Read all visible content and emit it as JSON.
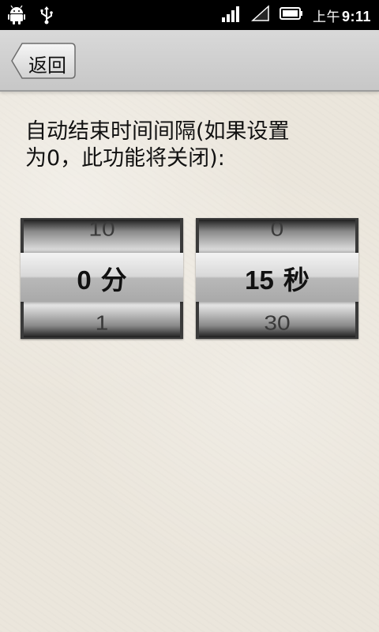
{
  "status_bar": {
    "icons": [
      "android-icon",
      "usb-icon",
      "signal-icon",
      "wifi-icon",
      "battery-icon"
    ],
    "ampm": "上午",
    "time": "9:11"
  },
  "header": {
    "back_label": "返回"
  },
  "description": {
    "line1": "自动结束时间间隔(如果设置",
    "line2": "为0，此功能将关闭):"
  },
  "pickers": {
    "minutes": {
      "prev": "10",
      "selected": "0",
      "unit": "分",
      "next": "1"
    },
    "seconds": {
      "prev": "0",
      "selected": "15",
      "unit": "秒",
      "next": "30"
    }
  }
}
